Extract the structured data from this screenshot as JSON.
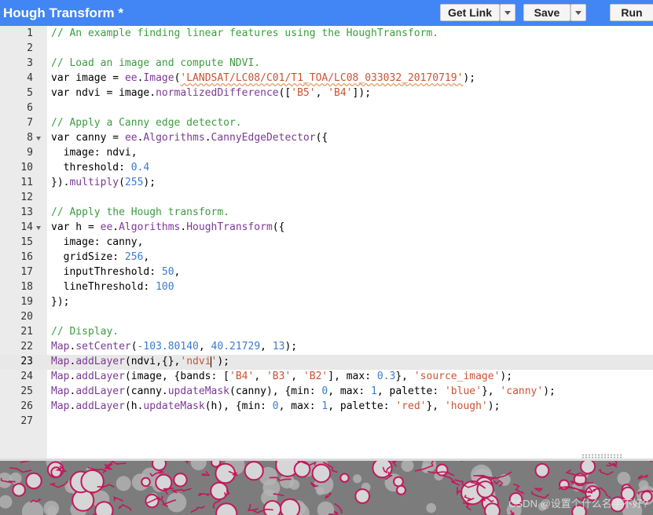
{
  "header": {
    "title": "Hough Transform *",
    "get_link_label": "Get Link",
    "save_label": "Save",
    "run_label": "Run",
    "accent_color": "#4285f4"
  },
  "editor": {
    "active_line": 23,
    "lines": [
      {
        "n": "1",
        "fold": false,
        "tokens": [
          [
            "comment",
            "// An example finding linear features using the HoughTransform."
          ]
        ]
      },
      {
        "n": "2",
        "fold": false,
        "tokens": []
      },
      {
        "n": "3",
        "fold": false,
        "tokens": [
          [
            "comment",
            "// Load an image and compute NDVI."
          ]
        ]
      },
      {
        "n": "4",
        "fold": false,
        "tokens": [
          [
            "kw",
            "var"
          ],
          [
            "pun",
            " image = "
          ],
          [
            "ee",
            "ee"
          ],
          [
            "pun",
            "."
          ],
          [
            "ee",
            "Image"
          ],
          [
            "pun",
            "("
          ],
          [
            "strsq",
            "'LANDSAT/LC08/C01/T1_TOA/LC08_033032_20170719'"
          ],
          [
            "pun",
            ");"
          ]
        ]
      },
      {
        "n": "5",
        "fold": false,
        "tokens": [
          [
            "kw",
            "var"
          ],
          [
            "pun",
            " ndvi = image."
          ],
          [
            "ee",
            "normalizedDifference"
          ],
          [
            "pun",
            "(["
          ],
          [
            "str",
            "'B5'"
          ],
          [
            "pun",
            ", "
          ],
          [
            "str",
            "'B4'"
          ],
          [
            "pun",
            "]);"
          ]
        ]
      },
      {
        "n": "6",
        "fold": false,
        "tokens": []
      },
      {
        "n": "7",
        "fold": false,
        "tokens": [
          [
            "comment",
            "// Apply a Canny edge detector."
          ]
        ]
      },
      {
        "n": "8",
        "fold": true,
        "tokens": [
          [
            "kw",
            "var"
          ],
          [
            "pun",
            " canny = "
          ],
          [
            "ee",
            "ee"
          ],
          [
            "pun",
            "."
          ],
          [
            "ee",
            "Algorithms"
          ],
          [
            "pun",
            "."
          ],
          [
            "ee",
            "CannyEdgeDetector"
          ],
          [
            "pun",
            "({"
          ]
        ]
      },
      {
        "n": "9",
        "fold": false,
        "tokens": [
          [
            "pun",
            "  image: ndvi,"
          ]
        ]
      },
      {
        "n": "10",
        "fold": false,
        "tokens": [
          [
            "pun",
            "  threshold: "
          ],
          [
            "num",
            "0.4"
          ]
        ]
      },
      {
        "n": "11",
        "fold": false,
        "tokens": [
          [
            "pun",
            "})."
          ],
          [
            "ee",
            "multiply"
          ],
          [
            "pun",
            "("
          ],
          [
            "num",
            "255"
          ],
          [
            "pun",
            ");"
          ]
        ]
      },
      {
        "n": "12",
        "fold": false,
        "tokens": []
      },
      {
        "n": "13",
        "fold": false,
        "tokens": [
          [
            "comment",
            "// Apply the Hough transform."
          ]
        ]
      },
      {
        "n": "14",
        "fold": true,
        "tokens": [
          [
            "kw",
            "var"
          ],
          [
            "pun",
            " h = "
          ],
          [
            "ee",
            "ee"
          ],
          [
            "pun",
            "."
          ],
          [
            "ee",
            "Algorithms"
          ],
          [
            "pun",
            "."
          ],
          [
            "ee",
            "HoughTransform"
          ],
          [
            "pun",
            "({"
          ]
        ]
      },
      {
        "n": "15",
        "fold": false,
        "tokens": [
          [
            "pun",
            "  image: canny,"
          ]
        ]
      },
      {
        "n": "16",
        "fold": false,
        "tokens": [
          [
            "pun",
            "  gridSize: "
          ],
          [
            "num",
            "256"
          ],
          [
            "pun",
            ","
          ]
        ]
      },
      {
        "n": "17",
        "fold": false,
        "tokens": [
          [
            "pun",
            "  inputThreshold: "
          ],
          [
            "num",
            "50"
          ],
          [
            "pun",
            ","
          ]
        ]
      },
      {
        "n": "18",
        "fold": false,
        "tokens": [
          [
            "pun",
            "  lineThreshold: "
          ],
          [
            "num",
            "100"
          ]
        ]
      },
      {
        "n": "19",
        "fold": false,
        "tokens": [
          [
            "pun",
            "});"
          ]
        ]
      },
      {
        "n": "20",
        "fold": false,
        "tokens": []
      },
      {
        "n": "21",
        "fold": false,
        "tokens": [
          [
            "comment",
            "// Display."
          ]
        ]
      },
      {
        "n": "22",
        "fold": false,
        "tokens": [
          [
            "ee",
            "Map"
          ],
          [
            "pun",
            "."
          ],
          [
            "ee",
            "setCenter"
          ],
          [
            "pun",
            "("
          ],
          [
            "num",
            "-103.80140"
          ],
          [
            "pun",
            ", "
          ],
          [
            "num",
            "40.21729"
          ],
          [
            "pun",
            ", "
          ],
          [
            "num",
            "13"
          ],
          [
            "pun",
            ");"
          ]
        ]
      },
      {
        "n": "23",
        "fold": false,
        "tokens": [
          [
            "ee",
            "Map"
          ],
          [
            "pun",
            "."
          ],
          [
            "ee",
            "addLayer"
          ],
          [
            "pun",
            "(ndvi,{},"
          ],
          [
            "str",
            "'ndvi"
          ],
          [
            "cursor",
            ""
          ],
          [
            "str",
            "'"
          ],
          [
            "pun",
            ");"
          ]
        ]
      },
      {
        "n": "24",
        "fold": false,
        "tokens": [
          [
            "ee",
            "Map"
          ],
          [
            "pun",
            "."
          ],
          [
            "ee",
            "addLayer"
          ],
          [
            "pun",
            "(image, {bands: ["
          ],
          [
            "str",
            "'B4'"
          ],
          [
            "pun",
            ", "
          ],
          [
            "str",
            "'B3'"
          ],
          [
            "pun",
            ", "
          ],
          [
            "str",
            "'B2'"
          ],
          [
            "pun",
            "], max: "
          ],
          [
            "num",
            "0.3"
          ],
          [
            "pun",
            "}, "
          ],
          [
            "str",
            "'source_image'"
          ],
          [
            "pun",
            ");"
          ]
        ]
      },
      {
        "n": "25",
        "fold": false,
        "tokens": [
          [
            "ee",
            "Map"
          ],
          [
            "pun",
            "."
          ],
          [
            "ee",
            "addLayer"
          ],
          [
            "pun",
            "(canny."
          ],
          [
            "ee",
            "updateMask"
          ],
          [
            "pun",
            "(canny), {min: "
          ],
          [
            "num",
            "0"
          ],
          [
            "pun",
            ", max: "
          ],
          [
            "num",
            "1"
          ],
          [
            "pun",
            ", palette: "
          ],
          [
            "str",
            "'blue'"
          ],
          [
            "pun",
            "}, "
          ],
          [
            "str",
            "'canny'"
          ],
          [
            "pun",
            ");"
          ]
        ]
      },
      {
        "n": "26",
        "fold": false,
        "tokens": [
          [
            "ee",
            "Map"
          ],
          [
            "pun",
            "."
          ],
          [
            "ee",
            "addLayer"
          ],
          [
            "pun",
            "(h."
          ],
          [
            "ee",
            "updateMask"
          ],
          [
            "pun",
            "(h), {min: "
          ],
          [
            "num",
            "0"
          ],
          [
            "pun",
            ", max: "
          ],
          [
            "num",
            "1"
          ],
          [
            "pun",
            ", palette: "
          ],
          [
            "str",
            "'red'"
          ],
          [
            "pun",
            "}, "
          ],
          [
            "str",
            "'hough'"
          ],
          [
            "pun",
            ");"
          ]
        ]
      },
      {
        "n": "27",
        "fold": false,
        "tokens": []
      }
    ]
  },
  "map": {
    "edge_color": "#c2185b",
    "base_color": "#7c7c7c",
    "watermark": "CSDN @设置个什么名字不好?"
  }
}
